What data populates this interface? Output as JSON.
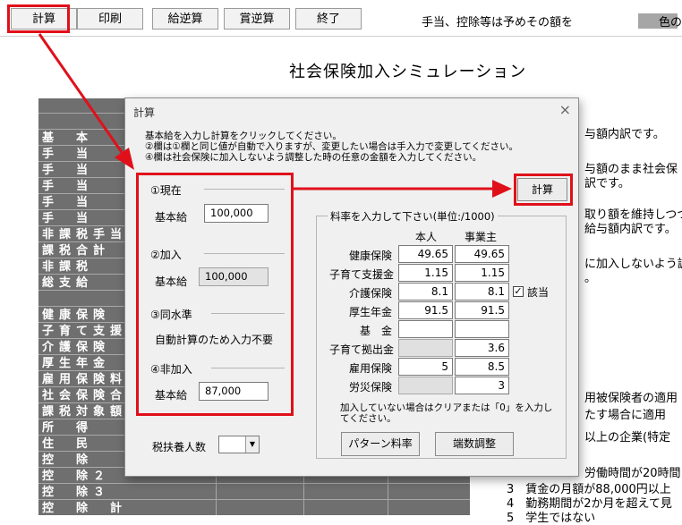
{
  "toolbar": {
    "buttons": [
      "計算",
      "印刷",
      "給逆算",
      "賞逆算",
      "終了"
    ],
    "note": "手当、控除等は予めその額を",
    "note_right": "色の"
  },
  "page_title": "社会保険加入シミュレーション",
  "background_table": {
    "rows": [
      "",
      "",
      "基　本",
      "手　当",
      "手　当",
      "手　当",
      "手　当",
      "手　当",
      "非課税手当",
      "課税合計",
      "非課税",
      "総支給",
      "",
      "健康保険",
      "子育て支援金",
      "介護保険",
      "厚生年金",
      "雇用保険料",
      "社会保険合計",
      "課税対象額",
      "所　得",
      "住　民",
      "控　除",
      "控　除２",
      "控　除３",
      "控　除　計"
    ]
  },
  "right_texts": [
    "与額内訳です。",
    "与額のまま社会保",
    "訳です。",
    "取り額を維持しつつ",
    "給与額内訳です。",
    "に加入しないよう調",
    "。",
    "用被保険者の適用",
    "たす場合に適用",
    "以上の企業(特定",
    "労働時間が20時間",
    "3　賃金の月額が88,000円以上",
    "4　勤務期間が2か月を超えて見",
    "5　学生ではない"
  ],
  "dialog": {
    "title": "計算",
    "close": "×",
    "instructions": [
      "基本給を入力し計算をクリックしてください。",
      "②欄は①欄と同じ値が自動で入りますが、変更したい場合は手入力で変更してください。",
      "④欄は社会保険に加入しないよう調整した時の任意の金額を入力してください。"
    ],
    "calc_button": "計算",
    "groups": {
      "current": {
        "title": "①現在",
        "label": "基本給",
        "value": "100,000"
      },
      "join": {
        "title": "②加入",
        "label": "基本給",
        "value": "100,000"
      },
      "same": {
        "title": "③同水準",
        "note": "自動計算のため入力不要"
      },
      "nonjoin": {
        "title": "④非加入",
        "label": "基本給",
        "value": "87,000"
      }
    },
    "dependents_label": "税扶養人数",
    "dependents_value": "",
    "rates": {
      "title": "料率を入力して下さい(単位:/1000)",
      "col_self": "本人",
      "col_employer": "事業主",
      "rows": [
        {
          "label": "健康保険",
          "self": "49.65",
          "employer": "49.65"
        },
        {
          "label": "子育て支援金",
          "self": "1.15",
          "employer": "1.15"
        },
        {
          "label": "介護保険",
          "self": "8.1",
          "employer": "8.1"
        },
        {
          "label": "厚生年金",
          "self": "91.5",
          "employer": "91.5"
        },
        {
          "label": "基　金",
          "self": "",
          "employer": ""
        },
        {
          "label": "子育て拠出金",
          "self": "",
          "employer": "3.6"
        },
        {
          "label": "雇用保険",
          "self": "5",
          "employer": "8.5"
        },
        {
          "label": "労災保険",
          "self": "",
          "employer": "3"
        }
      ],
      "applicable_label": "該当",
      "applicable_checked": "✓",
      "hint": "加入していない場合はクリアまたは「0」を入力してください。",
      "pattern_button": "パターン料率",
      "rounding_button": "端数調整"
    }
  },
  "colors": {
    "annotation_red": "#e0101a",
    "table_gray": "#6f6f6f"
  }
}
